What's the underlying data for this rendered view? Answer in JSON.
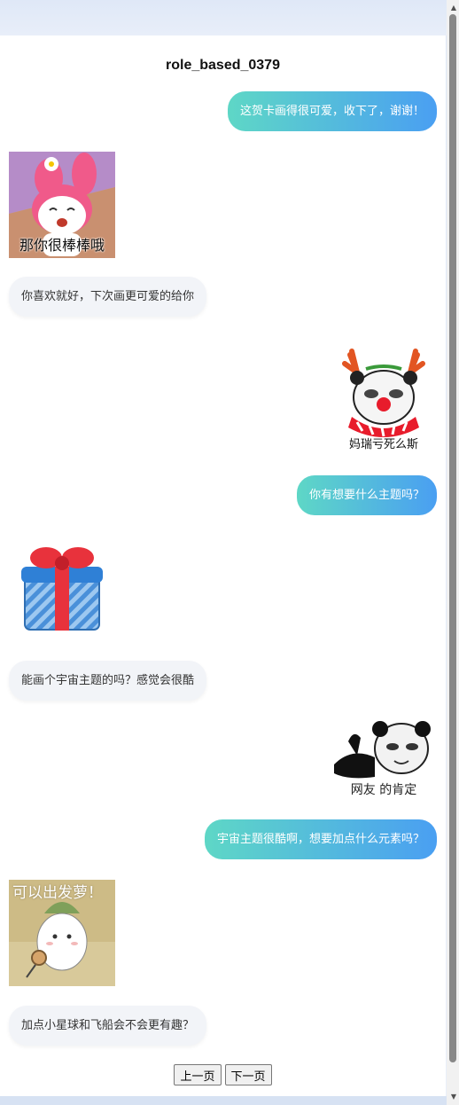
{
  "page": {
    "title": "role_based_0379"
  },
  "messages": [
    {
      "side": "right",
      "type": "text",
      "text": "这贺卡画得很可爱，收下了，谢谢！"
    },
    {
      "side": "left",
      "type": "sticker",
      "caption": "那你很棒棒哦",
      "icon": "pink-bunny-sticker"
    },
    {
      "side": "left",
      "type": "text",
      "text": "你喜欢就好，下次画更可爱的给你"
    },
    {
      "side": "right",
      "type": "sticker",
      "caption": "妈瑞亏死么斯",
      "icon": "reindeer-panda-sticker"
    },
    {
      "side": "right",
      "type": "text",
      "text": "你有想要什么主题吗？"
    },
    {
      "side": "left",
      "type": "sticker",
      "caption": "",
      "icon": "gift-box-sticker"
    },
    {
      "side": "left",
      "type": "text",
      "text": "能画个宇宙主题的吗？感觉会很酷"
    },
    {
      "side": "right",
      "type": "sticker",
      "caption": "网友 的肯定",
      "icon": "thumbs-up-panda-sticker"
    },
    {
      "side": "right",
      "type": "text",
      "text": "宇宙主题很酷啊，想要加点什么元素吗？"
    },
    {
      "side": "left",
      "type": "sticker",
      "caption": "可以出发萝！",
      "icon": "radish-sticker"
    },
    {
      "side": "left",
      "type": "text",
      "text": "加点小星球和飞船会不会更有趣？"
    }
  ],
  "pager": {
    "prev": "上一页",
    "next": "下一页"
  },
  "colors": {
    "bubble_gradient_start": "#5ed7c6",
    "bubble_gradient_end": "#4a9ff2",
    "left_bubble": "#f2f4f8"
  }
}
